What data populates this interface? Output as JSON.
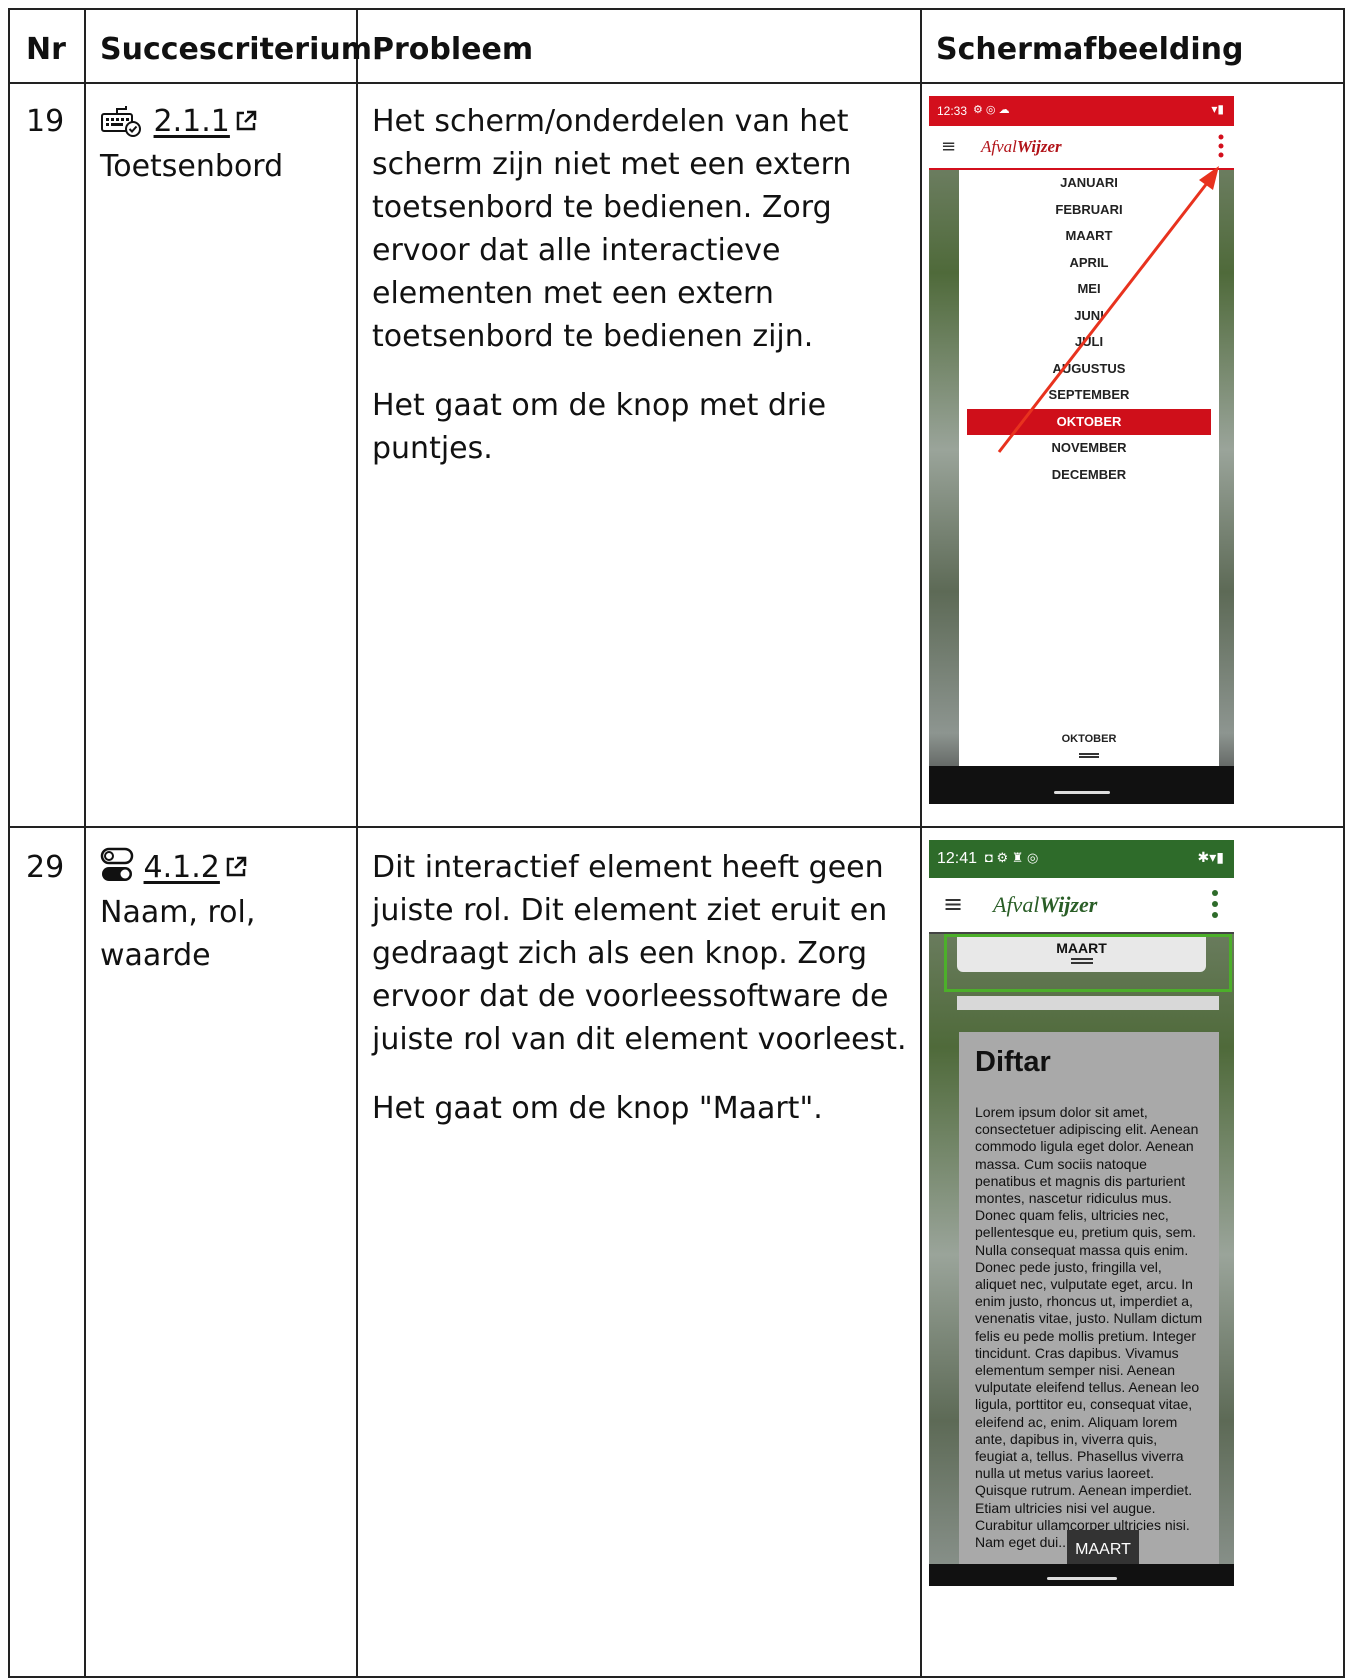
{
  "headers": {
    "nr": "Nr",
    "criterion": "Succescriterium",
    "problem": "Probleem",
    "screenshot": "Schermafbeelding"
  },
  "rows": [
    {
      "nr": "19",
      "criterion_code": "2.1.1",
      "criterion_name": "Toetsenbord",
      "criterion_icon": "keyboard-icon",
      "problem_p1": "Het scherm/onderdelen van het scherm zijn niet met een extern toetsenbord te bedienen. Zorg ervoor dat alle interactieve elementen met een extern toetsenbord te bedienen zijn.",
      "problem_p2": "Het gaat om de knop met drie puntjes.",
      "phone": {
        "time": "12:33",
        "brand_light": "Afval",
        "brand_bold": "Wijzer",
        "months": [
          "JANUARI",
          "FEBRUARI",
          "MAART",
          "APRIL",
          "MEI",
          "JUNI",
          "JULI",
          "AUGUSTUS",
          "SEPTEMBER",
          "OKTOBER",
          "NOVEMBER",
          "DECEMBER"
        ],
        "selected_month": "OKTOBER",
        "footer_month": "OKTOBER",
        "accent": "#d30f1c"
      }
    },
    {
      "nr": "29",
      "criterion_code": "4.1.2",
      "criterion_name": "Naam, rol, waarde",
      "criterion_icon": "toggle-icon",
      "problem_p1": "Dit interactief element heeft geen juiste rol. Dit element ziet eruit en gedraagt zich als een knop. Zorg ervoor dat de voorleessoftware de juiste rol van dit element voorleest.",
      "problem_p2": "Het gaat om de knop \"Maart\".",
      "phone": {
        "time": "12:41",
        "brand_light": "Afval",
        "brand_bold": "Wijzer",
        "top_month": "MAART",
        "card_title": "Diftar",
        "card_text": "Lorem ipsum dolor sit amet, consectetuer adipiscing elit. Aenean commodo ligula eget dolor. Aenean massa. Cum sociis natoque penatibus et magnis dis parturient montes, nascetur ridiculus mus. Donec quam felis, ultricies nec, pellentesque eu, pretium quis, sem. Nulla consequat massa quis enim. Donec pede justo, fringilla vel, aliquet nec, vulputate eget, arcu. In enim justo, rhoncus ut, imperdiet a, venenatis vitae, justo. Nullam dictum felis eu pede mollis pretium. Integer tincidunt. Cras dapibus. Vivamus elementum semper nisi. Aenean vulputate eleifend tellus. Aenean leo ligula, porttitor eu, consequat vitae, eleifend ac, enim. Aliquam lorem ante, dapibus in, viverra quis, feugiat a, tellus. Phasellus viverra nulla ut metus varius laoreet. Quisque rutrum. Aenean imperdiet. Etiam ultricies nisi vel augue. Curabitur ullamcorper ultricies nisi. Nam eget dui...",
        "bottom_button": "MAART",
        "accent": "#2e6b2a",
        "highlight": "#4caf2a"
      }
    }
  ]
}
